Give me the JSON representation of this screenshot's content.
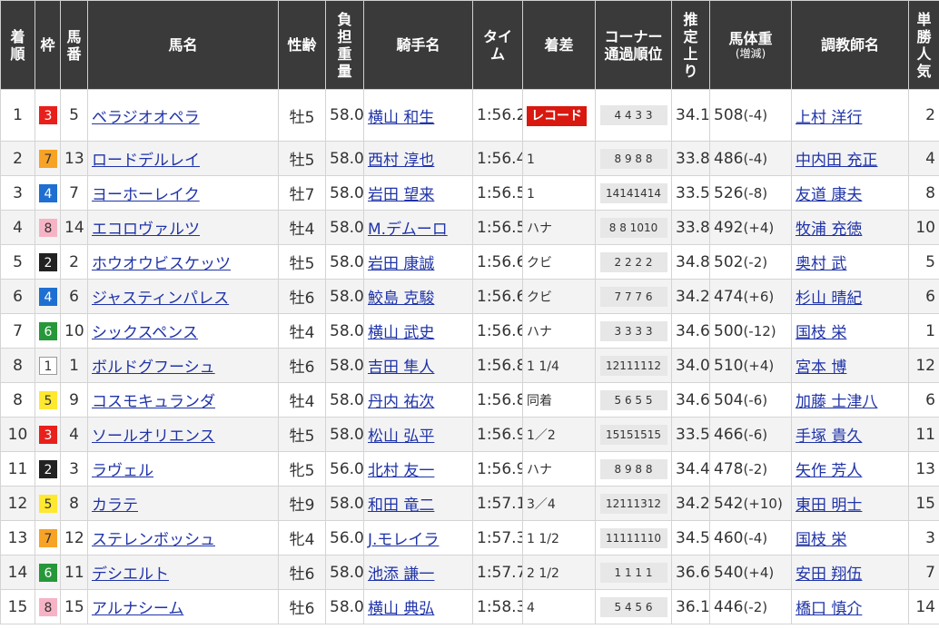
{
  "headers": {
    "finish": [
      "着",
      "順"
    ],
    "bracket": "枠",
    "horse_no": [
      "馬",
      "番"
    ],
    "horse_name": "馬名",
    "sex_age": "性齢",
    "weight_carried": [
      "負",
      "担",
      "重",
      "量"
    ],
    "jockey": "騎手名",
    "time": [
      "タイ",
      "ム"
    ],
    "margin": "着差",
    "corner": [
      "コーナー",
      "通過順位"
    ],
    "last3f": [
      "推",
      "定",
      "上",
      "り"
    ],
    "body_weight": "馬体重",
    "body_weight_sub": "(増減)",
    "trainer": "調教師名",
    "popularity": [
      "単",
      "勝",
      "人",
      "気"
    ]
  },
  "bracket_colors": {
    "1": {
      "bg": "#ffffff",
      "fg": "#333333",
      "border": "#999999"
    },
    "2": {
      "bg": "#222222",
      "fg": "#ffffff",
      "border": "#222222"
    },
    "3": {
      "bg": "#e8201b",
      "fg": "#ffffff",
      "border": "#e8201b"
    },
    "4": {
      "bg": "#1e6fd1",
      "fg": "#ffffff",
      "border": "#1e6fd1"
    },
    "5": {
      "bg": "#ffe830",
      "fg": "#333333",
      "border": "#ffe830"
    },
    "6": {
      "bg": "#27983a",
      "fg": "#ffffff",
      "border": "#27983a"
    },
    "7": {
      "bg": "#f7a326",
      "fg": "#333333",
      "border": "#f7a326"
    },
    "8": {
      "bg": "#f7b3c6",
      "fg": "#333333",
      "border": "#f7b3c6"
    }
  },
  "rows": [
    {
      "finish": "1",
      "bracket": "3",
      "no": "5",
      "name": "ベラジオオペラ",
      "sex_age": "牡5",
      "weight": "58.0",
      "jockey": "横山 和生",
      "time": "1:56.2",
      "margin": "",
      "record_label": "レコード",
      "corner": "4 4 3 3",
      "last3f": "34.1",
      "body_weight": "508",
      "body_change": "(-4)",
      "trainer": "上村 洋行",
      "pop": "2"
    },
    {
      "finish": "2",
      "bracket": "7",
      "no": "13",
      "name": "ロードデルレイ",
      "sex_age": "牡5",
      "weight": "58.0",
      "jockey": "西村 淳也",
      "time": "1:56.4",
      "margin": "1",
      "record_label": "",
      "corner": "8 9 8 8",
      "last3f": "33.8",
      "body_weight": "486",
      "body_change": "(-4)",
      "trainer": "中内田 充正",
      "pop": "4"
    },
    {
      "finish": "3",
      "bracket": "4",
      "no": "7",
      "name": "ヨーホーレイク",
      "sex_age": "牡7",
      "weight": "58.0",
      "jockey": "岩田 望来",
      "time": "1:56.5",
      "margin": "1",
      "record_label": "",
      "corner": "14141414",
      "last3f": "33.5",
      "body_weight": "526",
      "body_change": "(-8)",
      "trainer": "友道 康夫",
      "pop": "8"
    },
    {
      "finish": "4",
      "bracket": "8",
      "no": "14",
      "name": "エコロヴァルツ",
      "sex_age": "牡4",
      "weight": "58.0",
      "jockey": "M.デムーロ",
      "time": "1:56.5",
      "margin": "ハナ",
      "record_label": "",
      "corner": "8 8 1010",
      "last3f": "33.8",
      "body_weight": "492",
      "body_change": "(+4)",
      "trainer": "牧浦 充徳",
      "pop": "10"
    },
    {
      "finish": "5",
      "bracket": "2",
      "no": "2",
      "name": "ホウオウビスケッツ",
      "sex_age": "牡5",
      "weight": "58.0",
      "jockey": "岩田 康誠",
      "time": "1:56.6",
      "margin": "クビ",
      "record_label": "",
      "corner": "2 2 2 2",
      "last3f": "34.8",
      "body_weight": "502",
      "body_change": "(-2)",
      "trainer": "奥村 武",
      "pop": "5"
    },
    {
      "finish": "6",
      "bracket": "4",
      "no": "6",
      "name": "ジャスティンパレス",
      "sex_age": "牡6",
      "weight": "58.0",
      "jockey": "鮫島 克駿",
      "time": "1:56.6",
      "margin": "クビ",
      "record_label": "",
      "corner": "7 7 7 6",
      "last3f": "34.2",
      "body_weight": "474",
      "body_change": "(+6)",
      "trainer": "杉山 晴紀",
      "pop": "6"
    },
    {
      "finish": "7",
      "bracket": "6",
      "no": "10",
      "name": "シックスペンス",
      "sex_age": "牡4",
      "weight": "58.0",
      "jockey": "横山 武史",
      "time": "1:56.6",
      "margin": "ハナ",
      "record_label": "",
      "corner": "3 3 3 3",
      "last3f": "34.6",
      "body_weight": "500",
      "body_change": "(-12)",
      "trainer": "国枝 栄",
      "pop": "1"
    },
    {
      "finish": "8",
      "bracket": "1",
      "no": "1",
      "name": "ボルドグフーシュ",
      "sex_age": "牡6",
      "weight": "58.0",
      "jockey": "吉田 隼人",
      "time": "1:56.8",
      "margin": "1 1/4",
      "record_label": "",
      "corner": "12111112",
      "last3f": "34.0",
      "body_weight": "510",
      "body_change": "(+4)",
      "trainer": "宮本 博",
      "pop": "12"
    },
    {
      "finish": "8",
      "bracket": "5",
      "no": "9",
      "name": "コスモキュランダ",
      "sex_age": "牡4",
      "weight": "58.0",
      "jockey": "丹内 祐次",
      "time": "1:56.8",
      "margin": "同着",
      "record_label": "",
      "corner": "5 6 5 5",
      "last3f": "34.6",
      "body_weight": "504",
      "body_change": "(-6)",
      "trainer": "加藤 士津八",
      "pop": "6"
    },
    {
      "finish": "10",
      "bracket": "3",
      "no": "4",
      "name": "ソールオリエンス",
      "sex_age": "牡5",
      "weight": "58.0",
      "jockey": "松山 弘平",
      "time": "1:56.9",
      "margin": "1／2",
      "record_label": "",
      "corner": "15151515",
      "last3f": "33.5",
      "body_weight": "466",
      "body_change": "(-6)",
      "trainer": "手塚 貴久",
      "pop": "11"
    },
    {
      "finish": "11",
      "bracket": "2",
      "no": "3",
      "name": "ラヴェル",
      "sex_age": "牝5",
      "weight": "56.0",
      "jockey": "北村 友一",
      "time": "1:56.9",
      "margin": "ハナ",
      "record_label": "",
      "corner": "8 9 8 8",
      "last3f": "34.4",
      "body_weight": "478",
      "body_change": "(-2)",
      "trainer": "矢作 芳人",
      "pop": "13"
    },
    {
      "finish": "12",
      "bracket": "5",
      "no": "8",
      "name": "カラテ",
      "sex_age": "牡9",
      "weight": "58.0",
      "jockey": "和田 竜二",
      "time": "1:57.1",
      "margin": "3／4",
      "record_label": "",
      "corner": "12111312",
      "last3f": "34.2",
      "body_weight": "542",
      "body_change": "(+10)",
      "trainer": "東田 明士",
      "pop": "15"
    },
    {
      "finish": "13",
      "bracket": "7",
      "no": "12",
      "name": "ステレンボッシュ",
      "sex_age": "牝4",
      "weight": "56.0",
      "jockey": "J.モレイラ",
      "time": "1:57.3",
      "margin": "1 1/2",
      "record_label": "",
      "corner": "11111110",
      "last3f": "34.5",
      "body_weight": "460",
      "body_change": "(-4)",
      "trainer": "国枝 栄",
      "pop": "3"
    },
    {
      "finish": "14",
      "bracket": "6",
      "no": "11",
      "name": "デシエルト",
      "sex_age": "牡6",
      "weight": "58.0",
      "jockey": "池添 謙一",
      "time": "1:57.7",
      "margin": "2 1/2",
      "record_label": "",
      "corner": "1 1 1 1",
      "last3f": "36.6",
      "body_weight": "540",
      "body_change": "(+4)",
      "trainer": "安田 翔伍",
      "pop": "7"
    },
    {
      "finish": "15",
      "bracket": "8",
      "no": "15",
      "name": "アルナシーム",
      "sex_age": "牡6",
      "weight": "58.0",
      "jockey": "横山 典弘",
      "time": "1:58.3",
      "margin": "4",
      "record_label": "",
      "corner": "5 4 5 6",
      "last3f": "36.1",
      "body_weight": "446",
      "body_change": "(-2)",
      "trainer": "橋口 慎介",
      "pop": "14"
    }
  ]
}
